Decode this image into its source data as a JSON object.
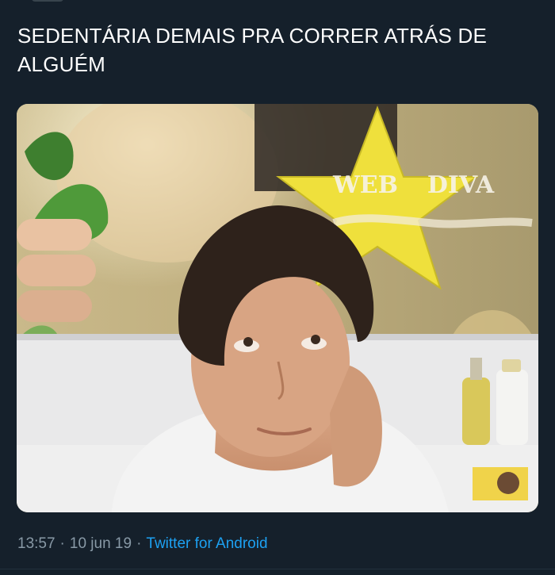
{
  "tweet": {
    "text": "SEDENTÁRIA DEMAIS PRA CORRER ATRÁS DE ALGUÉM",
    "time": "13:57",
    "date": "10 jun 19",
    "source": "Twitter for Android",
    "separator": "·"
  },
  "media": {
    "poster_text": [
      "WEB",
      "DIVA"
    ]
  },
  "colors": {
    "background": "#15202b",
    "text": "#ffffff",
    "secondary": "#8899a6",
    "link": "#1da1f2"
  }
}
